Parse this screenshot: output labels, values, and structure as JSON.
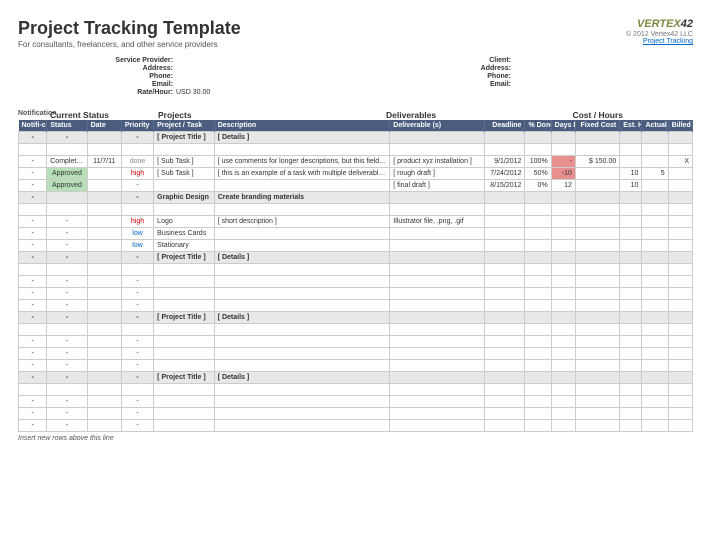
{
  "title": "Project Tracking Template",
  "subtitle": "For consultants, freelancers, and other service providers",
  "logo_brand": "VERTEX",
  "logo_num": "42",
  "copyright": "© 2012 Vertex42 LLC",
  "link_text": "Project Tracking",
  "provider": {
    "labels": {
      "sp": "Service Provider:",
      "addr": "Address:",
      "phone": "Phone:",
      "email": "Email:",
      "rate": "Rate/Hour:"
    },
    "rate_value": "USD 30.00"
  },
  "client": {
    "labels": {
      "client": "Client:",
      "addr": "Address:",
      "phone": "Phone:",
      "email": "Email:"
    }
  },
  "sections": {
    "notif": "Notification",
    "status": "Current Status",
    "projects": "Projects",
    "deliv": "Deliverables",
    "cost": "Cost / Hours"
  },
  "columns": {
    "notif": "Notifi-cations",
    "status": "Status",
    "date": "Date",
    "priority": "Priority",
    "project": "Project / Task",
    "desc": "Description",
    "deliv": "Deliverable (s)",
    "deadline": "Deadline",
    "pctdone": "% Done",
    "daysleft": "Days Left",
    "fixedcost": "Fixed Cost",
    "esthrs": "Est. Hrs",
    "acthrs": "Actual Hrs",
    "billedhrs": "Billed Hrs"
  },
  "rows": [
    {
      "type": "title",
      "notif": "-",
      "status": "-",
      "date": "",
      "priority": "-",
      "project": "[ Project Title ]",
      "desc": "[ Details ]"
    },
    {
      "type": "blank"
    },
    {
      "type": "data",
      "notif": "-",
      "status": "Completed",
      "date": "11/7/11",
      "priority": "done",
      "project": "[ Sub Task ]",
      "desc": "[ use comments for longer descriptions, but this field will also wrap ]",
      "deliv": "[ product xyz installation ]",
      "deadline": "9/1/2012",
      "pctdone": "100%",
      "daysleft": "-",
      "fixedcost": "$    150.00",
      "esthrs": "",
      "acthrs": "",
      "billedhrs": "X"
    },
    {
      "type": "data",
      "notif": "-",
      "status": "Approved",
      "date": "",
      "priority": "high",
      "project": "[ Sub Task ]",
      "desc": "[ this is an example of a task with multiple deliverables (rough and final drafts) ]",
      "deliv": "[ rough draft ]",
      "deadline": "7/24/2012",
      "pctdone": "50%",
      "daysleft": "-10",
      "fixedcost": "",
      "esthrs": "10",
      "acthrs": "5",
      "billedhrs": ""
    },
    {
      "type": "data",
      "notif": "-",
      "status": "Approved",
      "date": "",
      "priority": "-",
      "project": "",
      "desc": "",
      "deliv": "[ final draft ]",
      "deadline": "8/15/2012",
      "pctdone": "0%",
      "daysleft": "12",
      "fixedcost": "",
      "esthrs": "10",
      "acthrs": "",
      "billedhrs": ""
    },
    {
      "type": "subsec",
      "notif": "-",
      "status": "",
      "date": "",
      "priority": "-",
      "project": "Graphic Design",
      "desc": "Create branding materials"
    },
    {
      "type": "blank"
    },
    {
      "type": "data",
      "notif": "-",
      "status": "-",
      "date": "",
      "priority": "high",
      "project": "Logo",
      "desc": "[ short description ]",
      "deliv": "Illustrator file, .png, .gif",
      "deadline": "",
      "pctdone": "",
      "daysleft": "",
      "fixedcost": "",
      "esthrs": "",
      "acthrs": "",
      "billedhrs": ""
    },
    {
      "type": "data",
      "notif": "-",
      "status": "-",
      "date": "",
      "priority": "low",
      "project": "Business Cards",
      "desc": "",
      "deliv": "",
      "deadline": "",
      "pctdone": "",
      "daysleft": "",
      "fixedcost": "",
      "esthrs": "",
      "acthrs": "",
      "billedhrs": ""
    },
    {
      "type": "data",
      "notif": "-",
      "status": "-",
      "date": "",
      "priority": "low",
      "project": "Stationary",
      "desc": "",
      "deliv": "",
      "deadline": "",
      "pctdone": "",
      "daysleft": "",
      "fixedcost": "",
      "esthrs": "",
      "acthrs": "",
      "billedhrs": ""
    },
    {
      "type": "title",
      "notif": "-",
      "status": "-",
      "date": "",
      "priority": "-",
      "project": "[ Project Title ]",
      "desc": "[ Details ]"
    },
    {
      "type": "blank"
    },
    {
      "type": "data",
      "notif": "-",
      "status": "-",
      "date": "",
      "priority": "-"
    },
    {
      "type": "data",
      "notif": "-",
      "status": "-",
      "date": "",
      "priority": "-"
    },
    {
      "type": "data",
      "notif": "-",
      "status": "-",
      "date": "",
      "priority": "-"
    },
    {
      "type": "title",
      "notif": "-",
      "status": "-",
      "date": "",
      "priority": "-",
      "project": "[ Project Title ]",
      "desc": "[ Details ]"
    },
    {
      "type": "blank"
    },
    {
      "type": "data",
      "notif": "-",
      "status": "-",
      "date": "",
      "priority": "-"
    },
    {
      "type": "data",
      "notif": "-",
      "status": "-",
      "date": "",
      "priority": "-"
    },
    {
      "type": "data",
      "notif": "-",
      "status": "-",
      "date": "",
      "priority": "-"
    },
    {
      "type": "title",
      "notif": "-",
      "status": "-",
      "date": "",
      "priority": "-",
      "project": "[ Project Title ]",
      "desc": "[ Details ]"
    },
    {
      "type": "blank"
    },
    {
      "type": "data",
      "notif": "-",
      "status": "-",
      "date": "",
      "priority": "-"
    },
    {
      "type": "data",
      "notif": "-",
      "status": "-",
      "date": "",
      "priority": "-"
    },
    {
      "type": "data",
      "notif": "-",
      "status": "-",
      "date": "",
      "priority": "-"
    }
  ],
  "footnote": "Insert new rows above this line"
}
